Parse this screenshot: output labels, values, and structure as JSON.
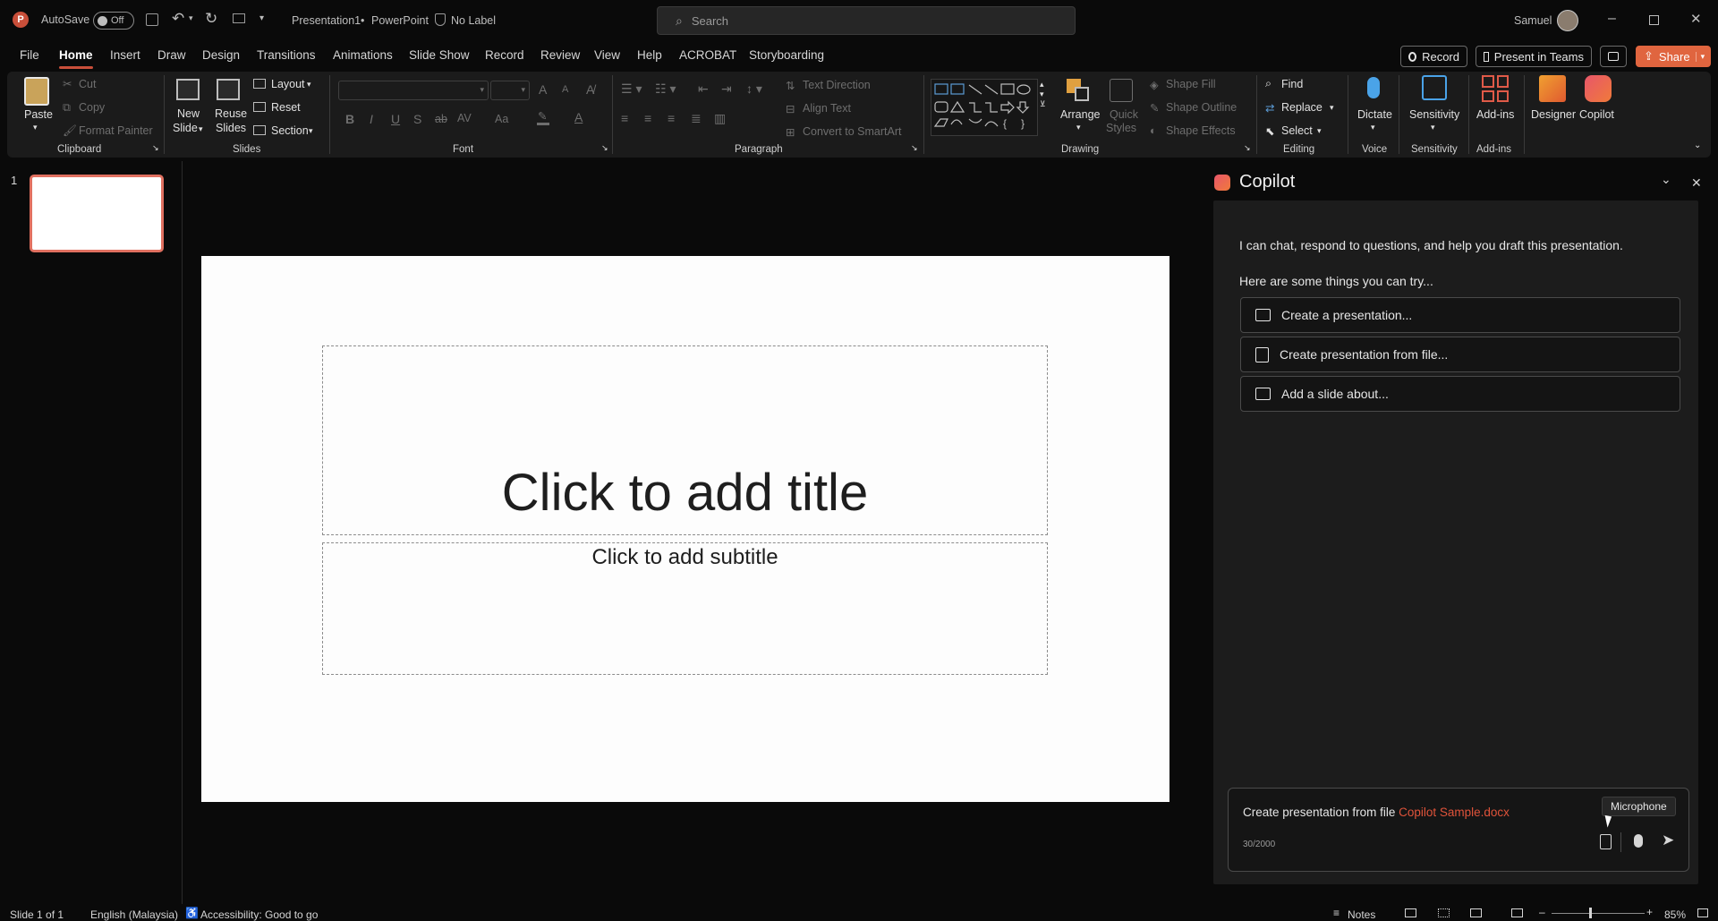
{
  "titlebar": {
    "autosave_label": "AutoSave",
    "autosave_state": "Off",
    "doc_title": "Presentation1",
    "separator": "•",
    "app_name": "PowerPoint",
    "sensitivity": "No Label",
    "search_placeholder": "Search",
    "user_name": "Samuel"
  },
  "tabs": [
    "File",
    "Home",
    "Insert",
    "Draw",
    "Design",
    "Transitions",
    "Animations",
    "Slide Show",
    "Record",
    "Review",
    "View",
    "Help",
    "ACROBAT",
    "Storyboarding"
  ],
  "tab_actions": {
    "record": "Record",
    "present_teams": "Present in Teams",
    "share": "Share"
  },
  "ribbon": {
    "clipboard": {
      "paste": "Paste",
      "cut": "Cut",
      "copy": "Copy",
      "format_painter": "Format Painter",
      "group": "Clipboard"
    },
    "slides": {
      "new_slide_1": "New",
      "new_slide_2": "Slide",
      "reuse_1": "Reuse",
      "reuse_2": "Slides",
      "layout": "Layout",
      "reset": "Reset",
      "section": "Section",
      "group": "Slides"
    },
    "font": {
      "group": "Font",
      "bold": "B",
      "italic": "I",
      "underline": "U",
      "shadow": "S",
      "strike": "ab",
      "spacing": "AV",
      "case": "Aa",
      "grow": "A",
      "shrink": "A"
    },
    "paragraph": {
      "group": "Paragraph",
      "text_direction": "Text Direction",
      "align_text": "Align Text",
      "convert_smartart": "Convert to SmartArt"
    },
    "drawing": {
      "group": "Drawing",
      "arrange": "Arrange",
      "quick_styles_1": "Quick",
      "quick_styles_2": "Styles",
      "shape_fill": "Shape Fill",
      "shape_outline": "Shape Outline",
      "shape_effects": "Shape Effects"
    },
    "editing": {
      "group": "Editing",
      "find": "Find",
      "replace": "Replace",
      "select": "Select"
    },
    "voice": {
      "group": "Voice",
      "dictate": "Dictate"
    },
    "sensitivity": {
      "group": "Sensitivity",
      "label": "Sensitivity"
    },
    "addins": {
      "group": "Add-ins",
      "label": "Add-ins"
    },
    "designer": "Designer",
    "copilot": "Copilot"
  },
  "thumbnails": [
    {
      "number": "1"
    }
  ],
  "slide": {
    "title_placeholder": "Click to add title",
    "subtitle_placeholder": "Click to add subtitle"
  },
  "copilot": {
    "header": "Copilot",
    "intro": "I can chat, respond to questions, and help you draft this presentation.",
    "suggest_heading": "Here are some things you can try...",
    "suggestions": [
      "Create a presentation...",
      "Create presentation from file...",
      "Add a slide about..."
    ],
    "input_text": "Create presentation from file ",
    "input_file": "Copilot Sample.docx",
    "char_count": "30/2000",
    "tooltip": "Microphone"
  },
  "statusbar": {
    "slide_count": "Slide 1 of 1",
    "language": "English (Malaysia)",
    "accessibility": "Accessibility: Good to go",
    "notes": "Notes",
    "zoom": "85%"
  },
  "colors": {
    "accent": "#c94f3a",
    "share": "#e0653f",
    "file_link": "#e0533a",
    "bg": "#0a0a0a",
    "ribbon": "#1b1b1b"
  }
}
